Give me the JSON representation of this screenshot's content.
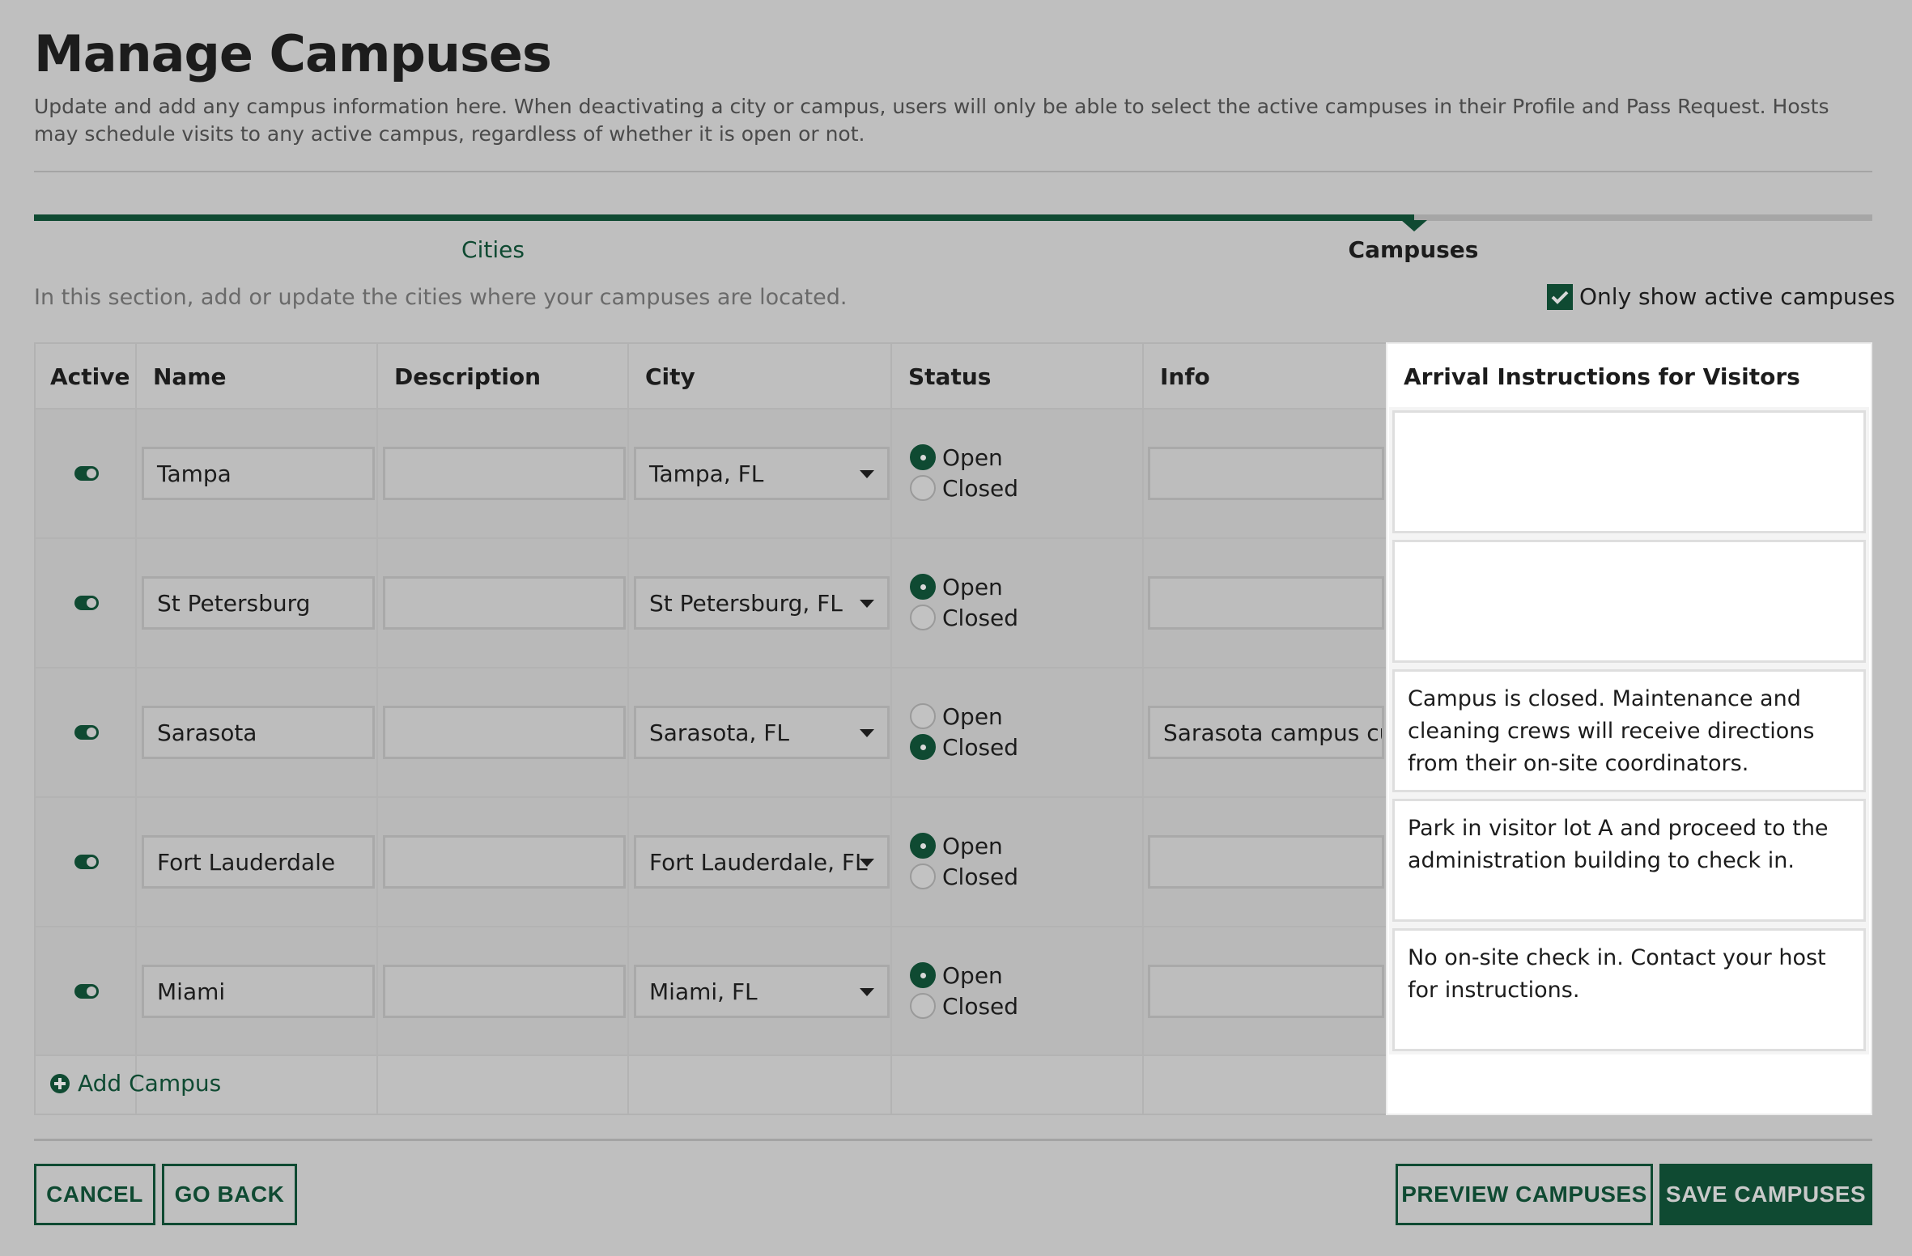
{
  "page": {
    "title": "Manage Campuses",
    "subtitle": "Update and add any campus information here. When deactivating a city or campus, users will only be able to select the active campuses in their Profile and Pass Request. Hosts may schedule visits to any active campus, regardless of whether it is open or not."
  },
  "stepper": {
    "steps": [
      {
        "label": "Cities",
        "state": "completed"
      },
      {
        "label": "Campuses",
        "state": "current"
      }
    ]
  },
  "section": {
    "description": "In this section, add or update the cities where your campuses are located.",
    "filter_label": "Only show active campuses",
    "filter_checked": true
  },
  "table": {
    "columns": [
      "Active",
      "Name",
      "Description",
      "City",
      "Status",
      "Info",
      "Arrival Instructions for Visitors"
    ],
    "status_options": [
      "Open",
      "Closed"
    ],
    "rows": [
      {
        "active": true,
        "name": "Tampa",
        "description": "",
        "city": "Tampa, FL",
        "status": "Open",
        "info": "",
        "arrival": ""
      },
      {
        "active": true,
        "name": "St Petersburg",
        "description": "",
        "city": "St Petersburg, FL",
        "status": "Open",
        "info": "",
        "arrival": ""
      },
      {
        "active": true,
        "name": "Sarasota",
        "description": "",
        "city": "Sarasota, FL",
        "status": "Closed",
        "info": "Sarasota campus cu",
        "arrival": "Campus is closed. Maintenance and cleaning crews will receive directions from their on-site coordinators."
      },
      {
        "active": true,
        "name": "Fort Lauderdale",
        "description": "",
        "city": "Fort Lauderdale, FL",
        "status": "Open",
        "info": "",
        "arrival": "Park in visitor lot A and proceed to the administration building to check in."
      },
      {
        "active": true,
        "name": "Miami",
        "description": "",
        "city": "Miami, FL",
        "status": "Open",
        "info": "",
        "arrival": "No on-site check in. Contact your host for instructions."
      }
    ],
    "add_label": "Add Campus"
  },
  "footer": {
    "cancel": "CANCEL",
    "go_back": "GO BACK",
    "preview": "PREVIEW CAMPUSES",
    "save": "SAVE CAMPUSES"
  },
  "colors": {
    "brand": "#0f4a32",
    "background": "#bfbfbf"
  }
}
